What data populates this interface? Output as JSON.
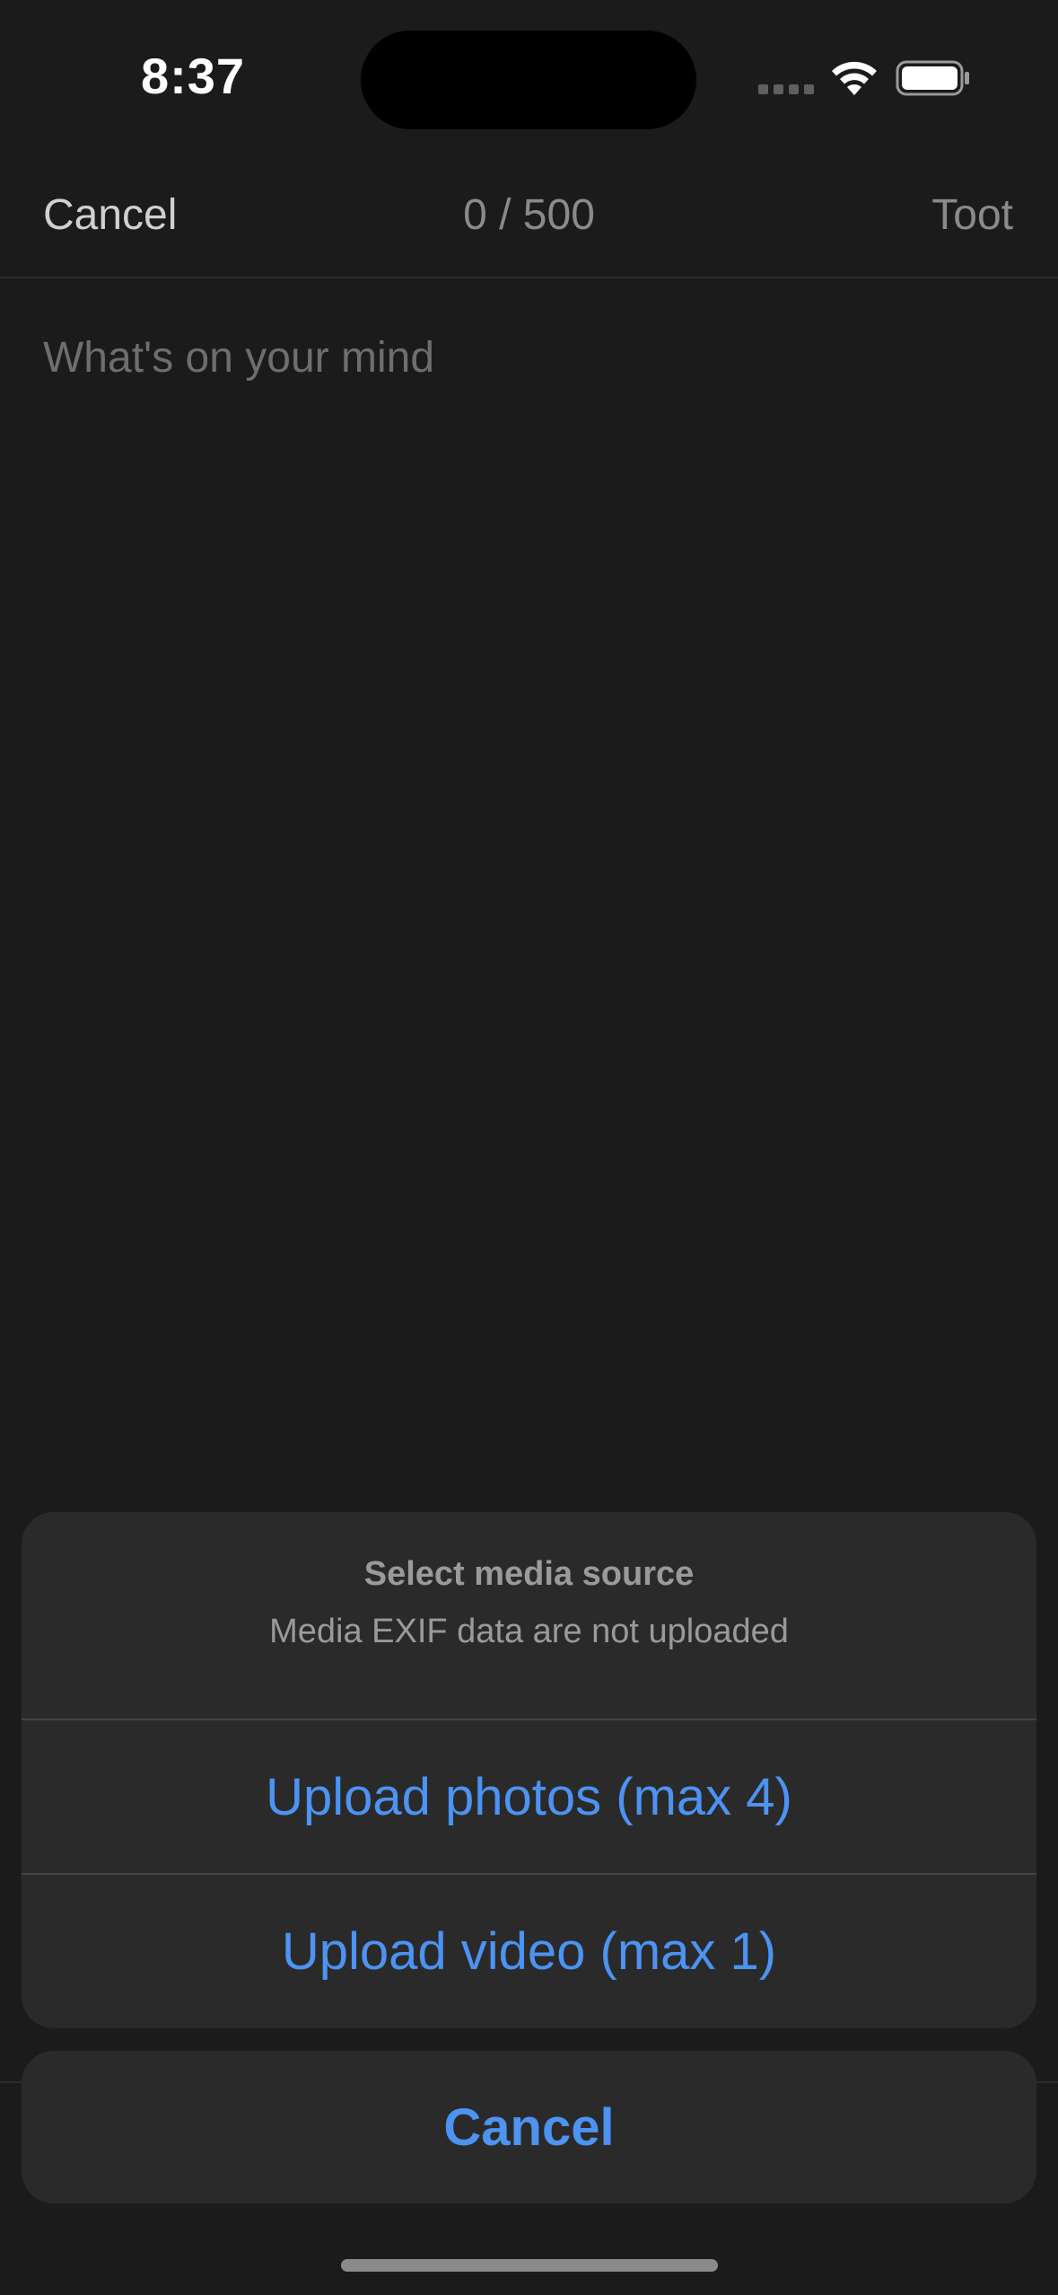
{
  "status_bar": {
    "time": "8:37",
    "icons": [
      "cellular-signal-icon",
      "wifi-icon",
      "battery-icon"
    ]
  },
  "header": {
    "cancel_label": "Cancel",
    "char_counter": "0 / 500",
    "toot_label": "Toot"
  },
  "compose": {
    "placeholder": "What's on your mind",
    "value": ""
  },
  "action_sheet": {
    "title": "Select media source",
    "message": "Media EXIF data are not uploaded",
    "actions": [
      {
        "label": "Upload photos (max 4)"
      },
      {
        "label": "Upload video (max 1)"
      }
    ],
    "cancel_label": "Cancel"
  },
  "colors": {
    "background": "#1b1b1b",
    "sheet_background": "#2a2a2a",
    "accent": "#4c93f2",
    "secondary_text": "#9a9a9a"
  }
}
